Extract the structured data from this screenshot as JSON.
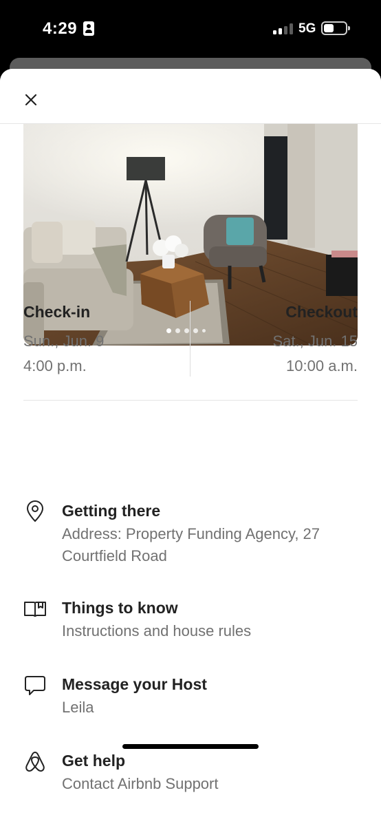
{
  "status_bar": {
    "time": "4:29",
    "network": "5G",
    "signal_bars_filled": 2,
    "signal_bars_total": 4,
    "battery_icon": "battery-icon",
    "id_icon": "person-id-icon"
  },
  "header": {
    "close_icon": "close-icon"
  },
  "photo": {
    "description_icon": "listing-photo",
    "dots_count": 5,
    "active_dot": 0
  },
  "checkin": {
    "label": "Check-in",
    "date": "Sun., Jun. 9",
    "time": "4:00 p.m."
  },
  "checkout": {
    "label": "Checkout",
    "date": "Sat., Jun. 15",
    "time": "10:00 a.m."
  },
  "rows": [
    {
      "icon": "location-pin-icon",
      "title": "Getting there",
      "subtitle": "Address: Property Funding Agency, 27 Courtfield Road"
    },
    {
      "icon": "book-icon",
      "title": "Things to know",
      "subtitle": "Instructions and house rules"
    },
    {
      "icon": "message-icon",
      "title": "Message your Host",
      "subtitle": "Leila"
    },
    {
      "icon": "airbnb-logo-icon",
      "title": "Get help",
      "subtitle": "Contact Airbnb Support"
    }
  ],
  "colors": {
    "primary_text": "#222222",
    "secondary_text": "#717171",
    "divider": "#dddddd"
  }
}
